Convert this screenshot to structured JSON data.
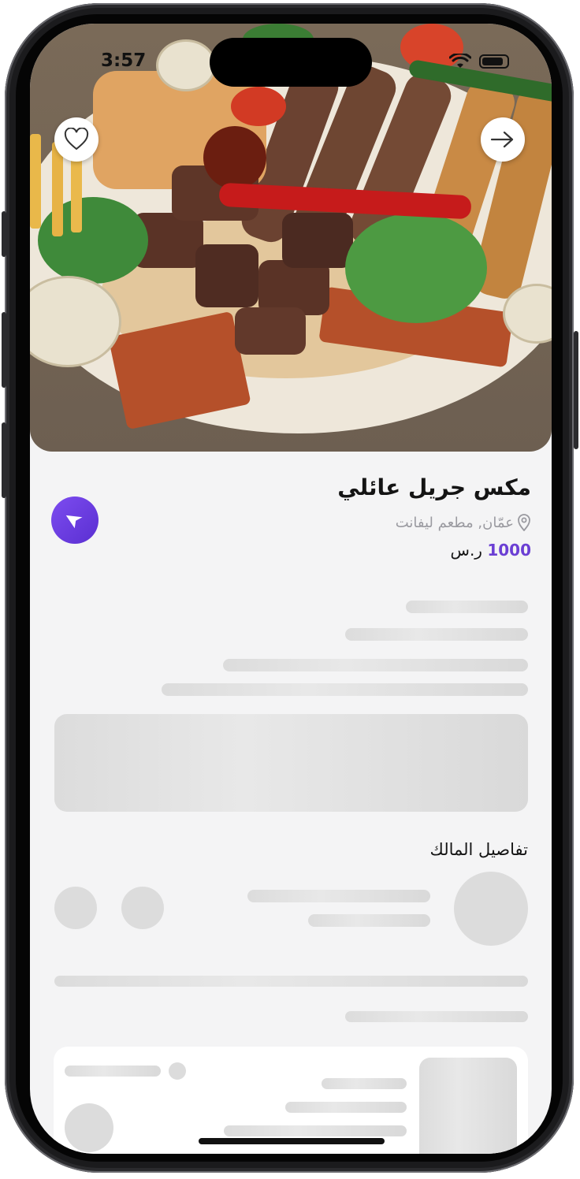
{
  "status_bar": {
    "time": "3:57"
  },
  "listing": {
    "title": "مكس جريل عائلي",
    "location": "عمّان, مطعم ليفانت",
    "price_value": "1000",
    "currency": "ر.س"
  },
  "owner_section": {
    "title": "تفاصيل المالك"
  },
  "icons": {
    "favorite": "heart-icon",
    "forward": "arrow-right-icon",
    "location_pin": "map-pin-icon",
    "navigate": "navigation-icon"
  },
  "colors": {
    "accent": "#6b3fd4",
    "background": "#f4f4f5",
    "skeleton": "#dcdcdc"
  }
}
